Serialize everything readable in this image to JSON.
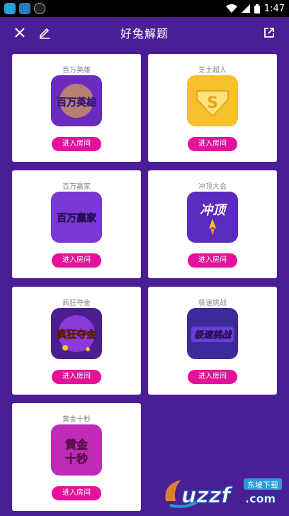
{
  "statusbar": {
    "time": "1:47"
  },
  "header": {
    "title": "好兔解题"
  },
  "rooms": [
    {
      "name": "百万英雄",
      "logo_text": "百万英雄",
      "button": "进入房间"
    },
    {
      "name": "芝士超人",
      "logo_text": "S",
      "button": "进入房间"
    },
    {
      "name": "百万赢家",
      "logo_text": "百万赢家",
      "button": "进入房间"
    },
    {
      "name": "冲顶大会",
      "logo_text": "冲顶",
      "button": "进入房间"
    },
    {
      "name": "疯狂夺金",
      "logo_text": "疯狂夺金",
      "button": "进入房间"
    },
    {
      "name": "极速挑战",
      "logo_text": "极速挑战",
      "button": "进入房间"
    },
    {
      "name": "黄金十秒",
      "logo_text": "黄金十秒",
      "button": "进入房间"
    }
  ],
  "watermark": {
    "text": "uzzf",
    "sub": "东坡下载",
    "domain": ".com"
  },
  "colors": {
    "background": "#4a1f96",
    "button": "#e4129a"
  }
}
